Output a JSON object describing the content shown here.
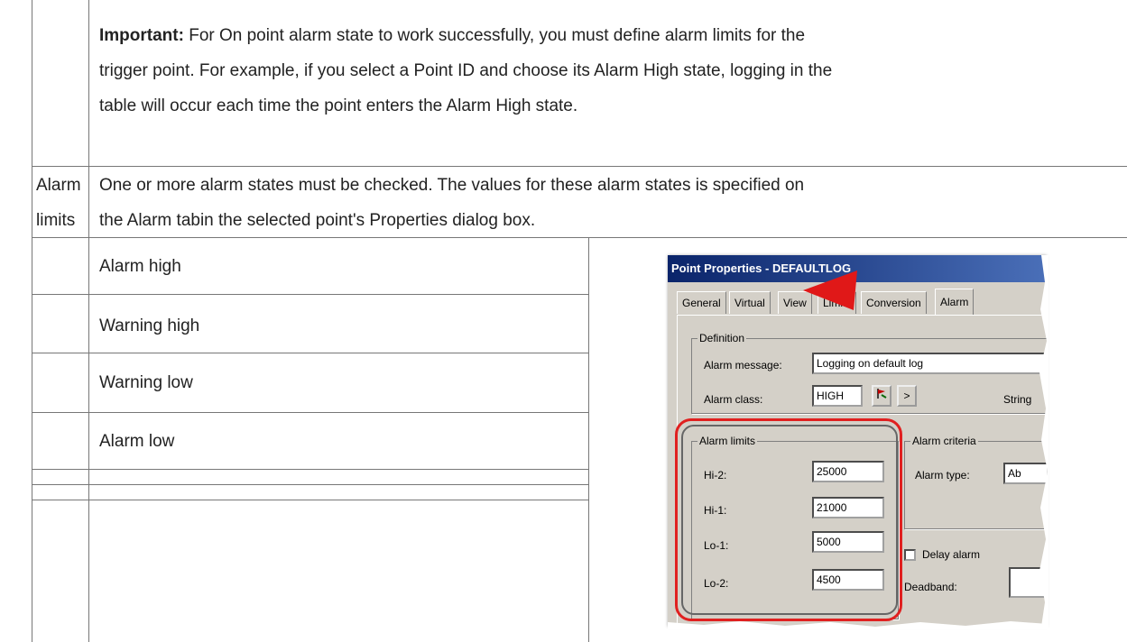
{
  "note": {
    "important_label": "Important:",
    "line1": " For On point alarm state to work successfully, you must define alarm limits for the",
    "line2": "trigger point. For example, if you select a Point ID and choose its Alarm High state, logging in the",
    "line3": "table will occur each time the point enters the Alarm High state."
  },
  "alarm_limits_row": {
    "term_line1": "Alarm",
    "term_line2": "limits",
    "desc_line1": "One or more alarm states must be checked. The values for these alarm states is specified on",
    "desc_line2": "the Alarm tabin the selected point's Properties dialog box."
  },
  "states": [
    "Alarm high",
    "Warning high",
    "Warning low",
    "Alarm low"
  ],
  "dialog": {
    "title": "Point Properties - DEFAULTLOG",
    "tabs": [
      "General",
      "Virtual",
      "View",
      "Limits",
      "Conversion",
      "Alarm"
    ],
    "definition_label": "Definition",
    "alarm_message_label": "Alarm message:",
    "alarm_message_value": "Logging on default log",
    "alarm_class_label": "Alarm class:",
    "alarm_class_value": "HIGH",
    "next_button": ">",
    "string_label": "String",
    "alarm_limits_label": "Alarm limits",
    "limits": [
      {
        "label": "Hi-2:",
        "value": "25000"
      },
      {
        "label": "Hi-1:",
        "value": "21000"
      },
      {
        "label": "Lo-1:",
        "value": "5000"
      },
      {
        "label": "Lo-2:",
        "value": "4500"
      }
    ],
    "alarm_criteria_label": "Alarm criteria",
    "alarm_type_label": "Alarm type:",
    "alarm_type_value": "Ab",
    "delay_alarm_label": "Delay alarm",
    "deadband_label": "Deadband:"
  },
  "colors": {
    "highlight": "#e02020",
    "arrow": "#e01818",
    "titlebar": "#0a246a"
  }
}
